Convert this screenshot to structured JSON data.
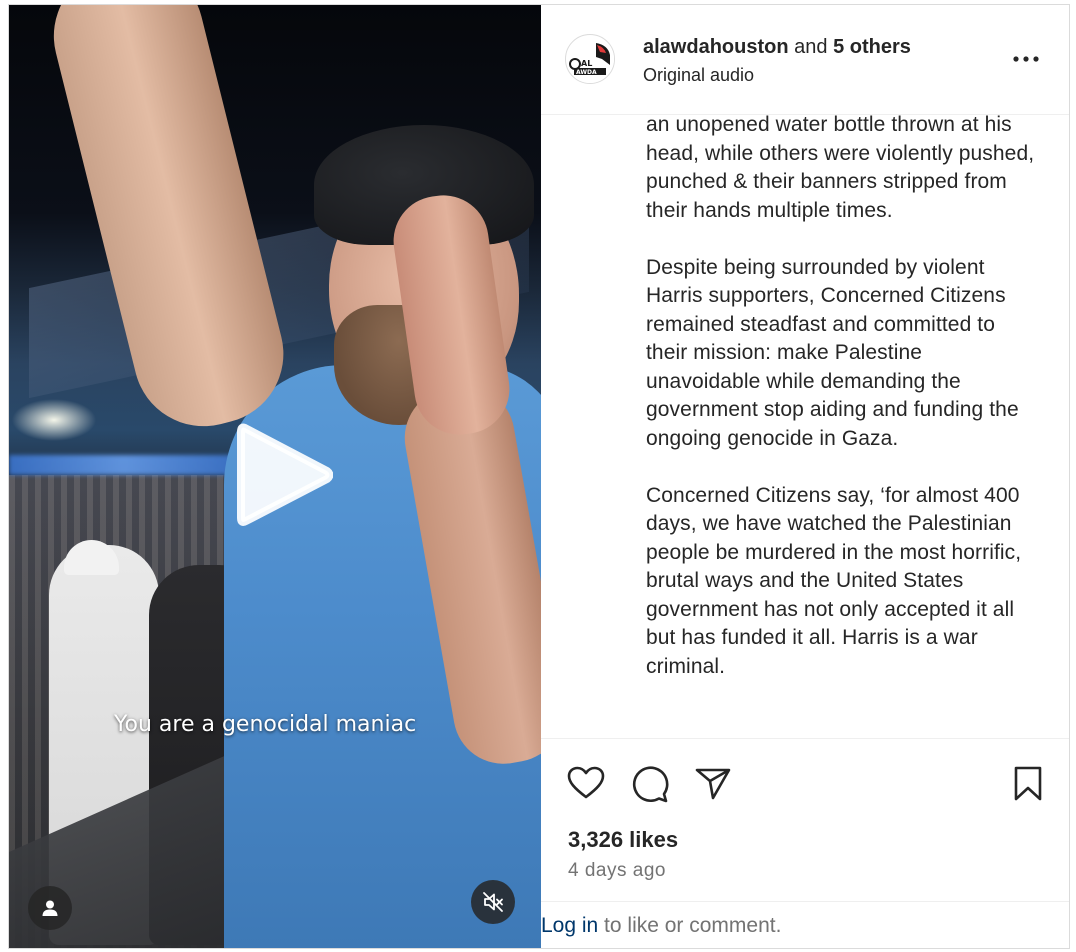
{
  "video": {
    "overlay_caption": "You are a genocidal maniac",
    "play_icon": "play-icon",
    "user_tag_icon": "user-icon",
    "mute_icon": "speaker-muted-icon"
  },
  "header": {
    "username": "alawdahouston",
    "and_text": "and",
    "others": "5 others",
    "audio": "Original audio",
    "avatar_text_top": "AL",
    "avatar_text_bottom": "AWDA",
    "more_icon": "more-options-icon"
  },
  "caption": {
    "paragraphs": [
      "an unopened water bottle thrown at his head, while others were violently pushed, punched & their banners stripped from their hands multiple times.",
      "Despite being surrounded by violent Harris supporters, Concerned Citizens remained steadfast and committed to their mission: make Palestine unavoidable while demanding the government stop aiding and funding the ongoing genocide in Gaza.",
      "Concerned Citizens say, ‘for almost 400 days, we have watched the Palestinian people be murdered in the most horrific, brutal ways and the United States government has not only accepted it all but has funded it all. Harris is a war criminal."
    ]
  },
  "actions": {
    "icons": [
      "heart-icon",
      "comment-icon",
      "share-icon",
      "bookmark-icon"
    ],
    "likes": "3,326 likes",
    "date": "4 days ago"
  },
  "login": {
    "link": "Log in",
    "rest": " to like or comment."
  },
  "colors": {
    "text": "#262626",
    "secondary": "#737373",
    "link": "#00376b",
    "border": "#dbdbdb"
  }
}
